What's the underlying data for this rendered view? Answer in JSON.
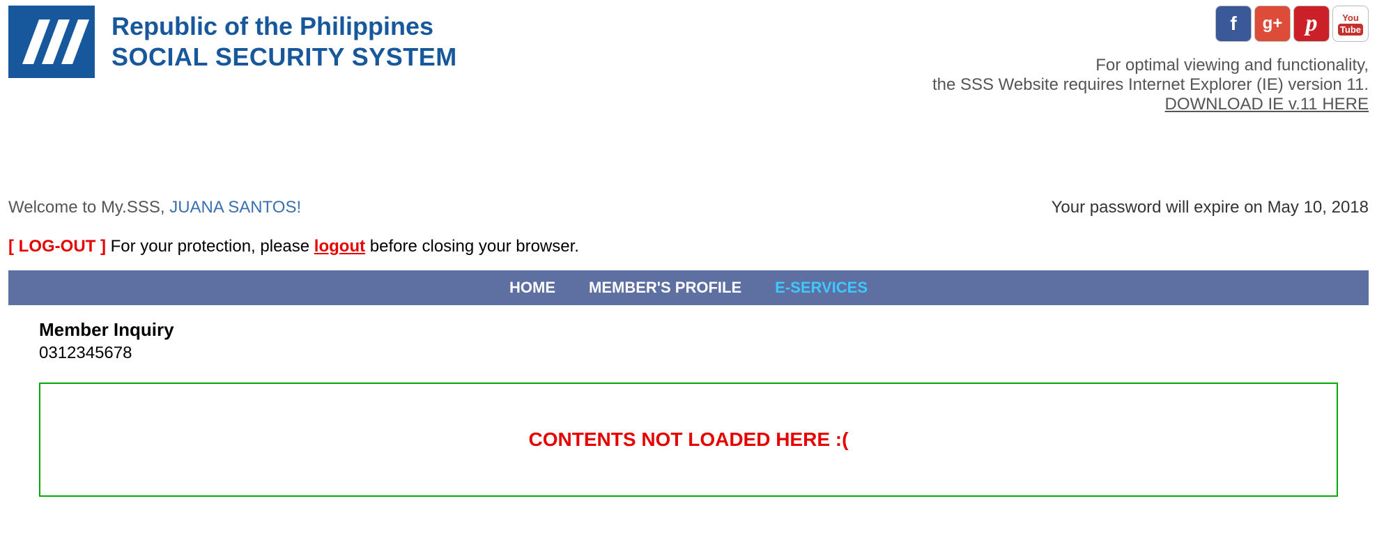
{
  "header": {
    "title_line1": "Republic of the Philippines",
    "title_line2": "SOCIAL SECURITY SYSTEM",
    "notice_line1": "For optimal viewing and functionality,",
    "notice_line2": "the SSS Website requires Internet Explorer (IE) version 11.",
    "download_link": "DOWNLOAD IE v.11 HERE"
  },
  "social": {
    "fb": "f",
    "gp": "g+",
    "pin": "p",
    "yt_top": "You",
    "yt_bottom": "Tube"
  },
  "welcome": {
    "prefix": "Welcome to My.SSS, ",
    "username": "JUANA SANTOS!",
    "pw_expire": "Your password will expire on May 10, 2018"
  },
  "logout": {
    "bracket": "[ LOG-OUT ]",
    "before": " For your protection, please ",
    "link": "logout",
    "after": " before closing your browser."
  },
  "nav": {
    "home": "HOME",
    "profile": "MEMBER'S PROFILE",
    "eservices": "E-SERVICES"
  },
  "inquiry": {
    "title": "Member Inquiry",
    "number": "0312345678"
  },
  "content": {
    "message": "CONTENTS NOT LOADED HERE :("
  }
}
